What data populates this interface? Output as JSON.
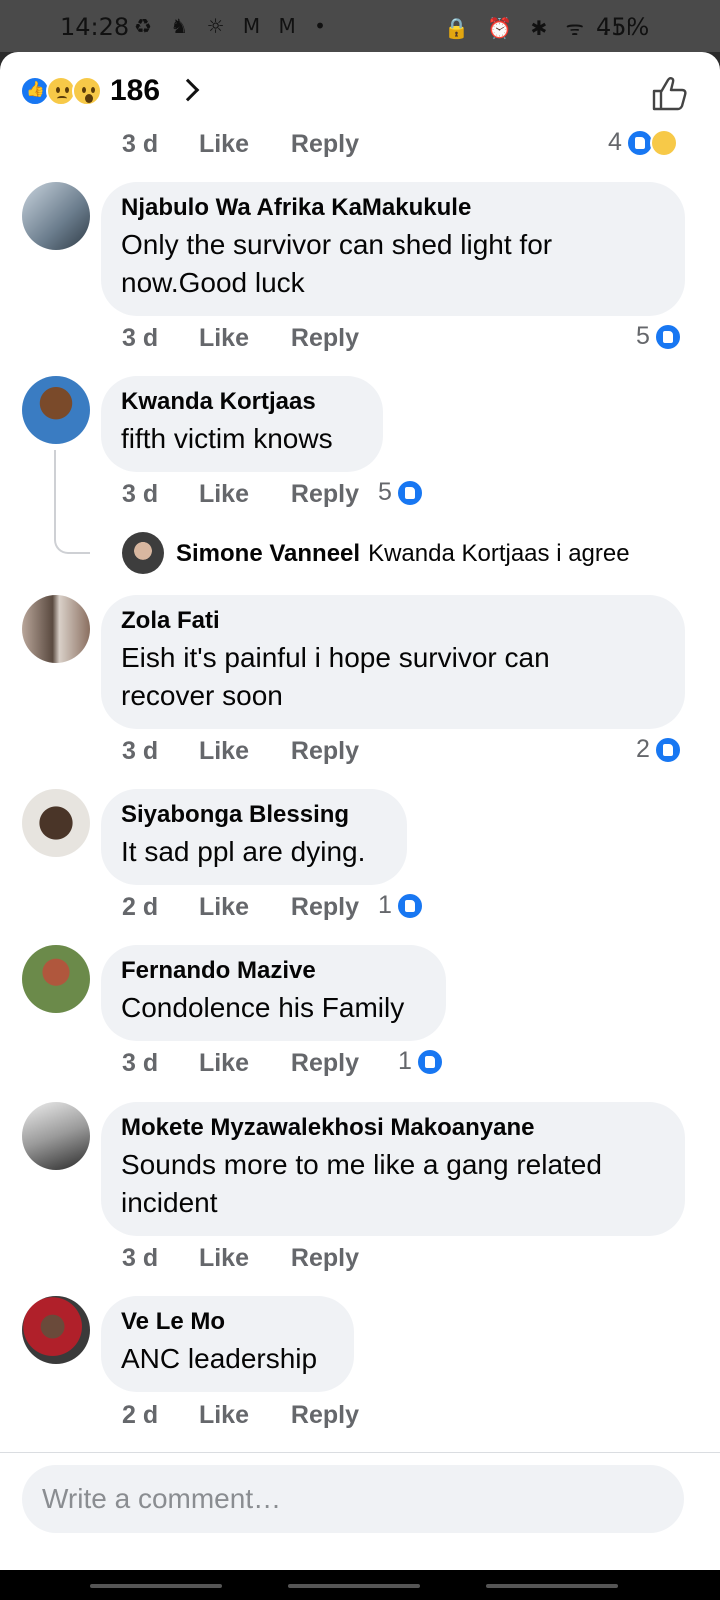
{
  "status_bar": {
    "time": "14:28",
    "left_icons": "♻ ♞ ☼ M M •",
    "right_icons": "🔒 ⏰ ✱ ᯤ .ıl",
    "battery": "45%"
  },
  "header": {
    "reactions": [
      "like-icon",
      "sad-icon",
      "wow-icon"
    ],
    "reaction_count": "186"
  },
  "top_meta": {
    "time": "3 d",
    "like": "Like",
    "reply": "Reply",
    "likes": "4"
  },
  "comments": [
    {
      "name": "Njabulo Wa Afrika KaMakukule",
      "line1": "Only the survivor can shed light for",
      "line2": "now.Good luck",
      "time": "3 d",
      "like": "Like",
      "reply": "Reply",
      "likes": "5"
    },
    {
      "name": "Kwanda Kortjaas",
      "line1": "fifth victim knows",
      "time": "3 d",
      "like": "Like",
      "reply": "Reply",
      "likes": "5"
    },
    {
      "name": "Zola Fati",
      "line1": "Eish it's painful i hope survivor can",
      "line2": "recover soon",
      "time": "3 d",
      "like": "Like",
      "reply": "Reply",
      "likes": "2"
    },
    {
      "name": "Siyabonga Blessing",
      "line1": "It sad ppl are dying.",
      "time": "2 d",
      "like": "Like",
      "reply": "Reply",
      "likes": "1"
    },
    {
      "name": "Fernando Mazive",
      "line1": "Condolence his Family",
      "time": "3 d",
      "like": "Like",
      "reply": "Reply",
      "likes": "1"
    },
    {
      "name": "Mokete Myzawalekhosi Makoanyane",
      "line1": "Sounds more to me like a gang related",
      "line2": "incident",
      "time": "3 d",
      "like": "Like",
      "reply": "Reply"
    },
    {
      "name": "Ve Le Mo",
      "line1": "ANC leadership",
      "time": "2 d",
      "like": "Like",
      "reply": "Reply"
    }
  ],
  "sub_reply": {
    "name": "Simone Vanneel",
    "text": "Kwanda Kortjaas i agree"
  },
  "composer": {
    "placeholder": "Write a comment…"
  },
  "colors": {
    "accent": "#1877f2",
    "bubble": "#f0f2f5",
    "meta_text": "#65676b"
  }
}
